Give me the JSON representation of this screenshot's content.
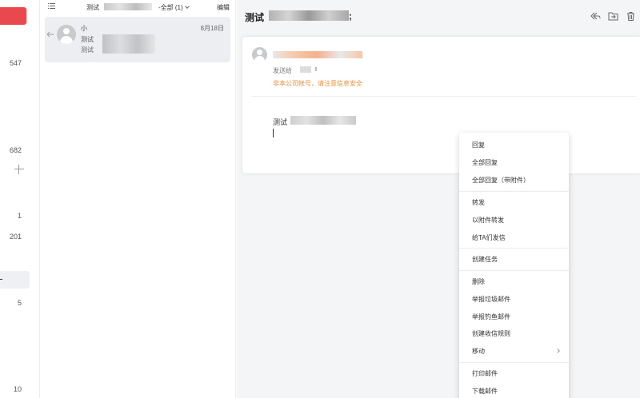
{
  "sidebar": {
    "counts": [
      "547",
      "682",
      "1",
      "201",
      "5",
      "10"
    ],
    "colors": {
      "compose": "#e9484d"
    }
  },
  "list": {
    "folder_name": "测试",
    "filter_label": "-全部 (1)",
    "edit_label": "编辑",
    "item": {
      "sender": "小",
      "date": "8月18日",
      "subject": "测试",
      "preview": "测试"
    }
  },
  "reader": {
    "title": "测试",
    "title_suffix": ";",
    "to_label": "发送给",
    "to_arrow": "⇕",
    "warning": "非本公司帐号，请注意信息安全",
    "body_text": "测试",
    "colors": {
      "warning": "#f08c3a"
    }
  },
  "context_menu": {
    "items": [
      "回复",
      "全部回复",
      "全部回复（带附件）",
      "转发",
      "以附件转发",
      "给TA们发信",
      "创建任务",
      "删除",
      "举报垃圾邮件",
      "举报钓鱼邮件",
      "创建收信规则",
      "移动",
      "打印邮件",
      "下载邮件"
    ]
  }
}
